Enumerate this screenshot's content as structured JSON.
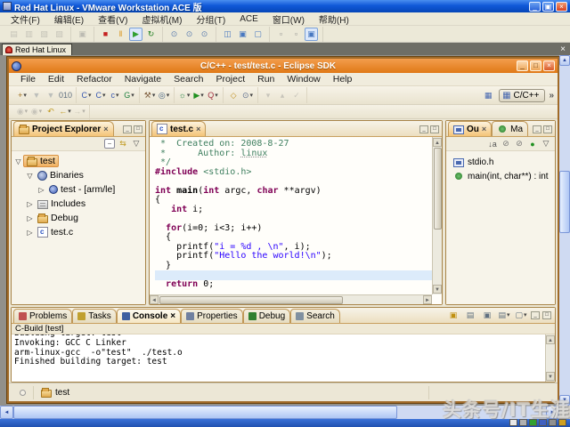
{
  "glyphs": {
    "min": "_",
    "restore": "▣",
    "max": "□",
    "close": "×",
    "up": "▲",
    "down": "▼",
    "left": "◄",
    "right": "►",
    "caret": "▾",
    "menu": "▽",
    "chevron": "»",
    "tab_close": "×",
    "collapse_all": "−",
    "link_editor": "⇆",
    "persp_icon": "▦",
    "open_persp_icon": "▦"
  },
  "vmware": {
    "title": "Red Hat Linux - VMware Workstation ACE 版",
    "menus": [
      "文件(F)",
      "编辑(E)",
      "查看(V)",
      "虚拟机(M)",
      "分组(T)",
      "ACE",
      "窗口(W)",
      "帮助(H)"
    ],
    "toolbar_groups": [
      [
        {
          "n": "vm-settings",
          "g": "▤",
          "c": "#8a8a7a",
          "d": true
        },
        {
          "n": "snapshot-manager",
          "g": "▥",
          "c": "#8a8a7a",
          "d": true
        },
        {
          "n": "clone-vm",
          "g": "▧",
          "c": "#8a8a7a",
          "d": true
        },
        {
          "n": "capture-movie",
          "g": "▨",
          "c": "#8a8a7a",
          "d": true
        }
      ],
      [
        {
          "n": "appliance",
          "g": "▣",
          "c": "#707a8a",
          "d": true
        }
      ],
      [
        {
          "n": "power-off",
          "g": "■",
          "c": "#c42020"
        },
        {
          "n": "suspend",
          "g": "‖",
          "c": "#d89010"
        },
        {
          "n": "power-on",
          "g": "▶",
          "c": "#30a030",
          "active": true
        },
        {
          "n": "reset",
          "g": "↻",
          "c": "#208020"
        }
      ],
      [
        {
          "n": "take-snapshot",
          "g": "⊙",
          "c": "#6080b0"
        },
        {
          "n": "revert-snapshot",
          "g": "⊙",
          "c": "#6080b0"
        },
        {
          "n": "manage-snapshots",
          "g": "⊙",
          "c": "#6080b0"
        }
      ],
      [
        {
          "n": "show-sidebar",
          "g": "◫",
          "c": "#4878c0"
        },
        {
          "n": "summary-view",
          "g": "▣",
          "c": "#4878c0"
        },
        {
          "n": "console-view",
          "g": "▢",
          "c": "#4878c0"
        }
      ],
      [
        {
          "n": "quick-switch",
          "g": "▫",
          "c": "#8a8a8a"
        },
        {
          "n": "fullscreen-mode",
          "g": "▫",
          "c": "#8a8a8a"
        },
        {
          "n": "unity-view",
          "g": "▣",
          "c": "#4878c0",
          "active": true
        }
      ]
    ],
    "tab": "Red Hat Linux"
  },
  "eclipse": {
    "title": "C/C++ - test/test.c - Eclipse SDK",
    "menus": [
      "File",
      "Edit",
      "Refactor",
      "Navigate",
      "Search",
      "Project",
      "Run",
      "Window",
      "Help"
    ],
    "toolbar1_groups": [
      [
        {
          "n": "new-wizard",
          "g": "+",
          "c": "#a07020",
          "caret": true
        },
        {
          "n": "save",
          "g": "▼",
          "c": "#607080",
          "d": true
        },
        {
          "n": "save-all",
          "g": "▼",
          "c": "#607080",
          "d": true
        },
        {
          "n": "build-all",
          "g": "010",
          "c": "#607080"
        }
      ],
      [
        {
          "n": "new-c-project",
          "g": "C",
          "c": "#3858b0",
          "caret": true
        },
        {
          "n": "new-cpp-project",
          "g": "C",
          "c": "#3858b0",
          "caret": true
        },
        {
          "n": "new-c-file",
          "g": "c",
          "c": "#3858b0",
          "caret": true
        },
        {
          "n": "code-template",
          "g": "G",
          "c": "#208040",
          "caret": true
        }
      ],
      [
        {
          "n": "build",
          "g": "⚒",
          "c": "#806040",
          "caret": true
        },
        {
          "n": "build-config",
          "g": "◎",
          "c": "#406080",
          "caret": true
        }
      ],
      [
        {
          "n": "debug",
          "g": "☼",
          "c": "#208040",
          "caret": true
        },
        {
          "n": "run",
          "g": "▶",
          "c": "#209020",
          "caret": true
        },
        {
          "n": "profile",
          "g": "Q",
          "c": "#a03040",
          "caret": true
        }
      ],
      [
        {
          "n": "open-element",
          "g": "◇",
          "c": "#c09020"
        },
        {
          "n": "search",
          "g": "⊙",
          "c": "#607090",
          "caret": true
        }
      ],
      [
        {
          "n": "toggle-mark",
          "g": "▾",
          "c": "#808080",
          "d": true
        },
        {
          "n": "previous-edit",
          "g": "▴",
          "c": "#808080",
          "d": true
        },
        {
          "n": "next-edit",
          "g": "✓",
          "c": "#808080",
          "d": true
        }
      ]
    ],
    "toolbar2_groups": [
      [
        {
          "n": "next-annotation",
          "g": "◉",
          "c": "#808080",
          "d": true,
          "caret": true
        },
        {
          "n": "previous-annotation",
          "g": "◉",
          "c": "#808080",
          "d": true,
          "caret": true
        },
        {
          "n": "last-edit-location",
          "g": "↶",
          "c": "#c09a20"
        },
        {
          "n": "back-history",
          "g": "←",
          "c": "#c09a20",
          "caret": true
        },
        {
          "n": "forward-history",
          "g": "→",
          "c": "#909080",
          "d": true,
          "caret": true
        }
      ]
    ],
    "perspective": {
      "button": "C/C++"
    },
    "project_explorer": {
      "title": "Project Explorer",
      "tree": [
        {
          "label": "test",
          "depth": 0,
          "arrow": "open",
          "icon": "project",
          "selected": true
        },
        {
          "label": "Binaries",
          "depth": 1,
          "arrow": "open",
          "icon": "binaries"
        },
        {
          "label": "test - [arm/le]",
          "depth": 2,
          "arrow": "closed",
          "icon": "binary"
        },
        {
          "label": "Includes",
          "depth": 1,
          "arrow": "closed",
          "icon": "includes"
        },
        {
          "label": "Debug",
          "depth": 1,
          "arrow": "closed",
          "icon": "folder"
        },
        {
          "label": "test.c",
          "depth": 1,
          "arrow": "closed",
          "icon": "cfile"
        }
      ]
    },
    "editor": {
      "tab": "test.c",
      "highlight_line": 14,
      "lines": [
        [
          {
            "t": " *  Created on: 2008-8-27",
            "s": "com"
          }
        ],
        [
          {
            "t": " *      Author: ",
            "s": "com"
          },
          {
            "t": "linux",
            "s": "comu"
          }
        ],
        [
          {
            "t": " */",
            "s": "com"
          }
        ],
        [
          {
            "t": "#include",
            "s": "pp"
          },
          {
            "t": " ",
            "s": "pl"
          },
          {
            "t": "<stdio.h>",
            "s": "inc"
          }
        ],
        [],
        [
          {
            "t": "int",
            "s": "kw"
          },
          {
            "t": " ",
            "s": "pl"
          },
          {
            "t": "main",
            "s": "fn"
          },
          {
            "t": "(",
            "s": "pl"
          },
          {
            "t": "int",
            "s": "kw"
          },
          {
            "t": " argc, ",
            "s": "pl"
          },
          {
            "t": "char",
            "s": "kw"
          },
          {
            "t": " **argv)",
            "s": "pl"
          }
        ],
        [
          {
            "t": "{",
            "s": "pl"
          }
        ],
        [
          {
            "t": "   ",
            "s": "pl"
          },
          {
            "t": "int",
            "s": "kw"
          },
          {
            "t": " i;",
            "s": "pl"
          }
        ],
        [],
        [
          {
            "t": "  ",
            "s": "pl"
          },
          {
            "t": "for",
            "s": "kw"
          },
          {
            "t": "(i=0; i<3; i++)",
            "s": "pl"
          }
        ],
        [
          {
            "t": "  {",
            "s": "pl"
          }
        ],
        [
          {
            "t": "    printf(",
            "s": "pl"
          },
          {
            "t": "\"i = %d , \\n\"",
            "s": "str"
          },
          {
            "t": ", i);",
            "s": "pl"
          }
        ],
        [
          {
            "t": "    printf(",
            "s": "pl"
          },
          {
            "t": "\"Hello the world!\\n\"",
            "s": "str"
          },
          {
            "t": ");",
            "s": "pl"
          }
        ],
        [
          {
            "t": "  }",
            "s": "pl"
          }
        ],
        [],
        [
          {
            "t": "  ",
            "s": "pl"
          },
          {
            "t": "return",
            "s": "kw"
          },
          {
            "t": " 0;",
            "s": "pl"
          }
        ]
      ]
    },
    "outline": {
      "tabs": [
        {
          "label": "Ou",
          "active": true
        },
        {
          "label": "Ma",
          "active": false
        }
      ],
      "toolbar": [
        {
          "n": "sort",
          "g": "↓a",
          "c": "#555"
        },
        {
          "n": "hide-fields",
          "g": "⊘",
          "c": "#777"
        },
        {
          "n": "hide-static",
          "g": "⊘",
          "c": "#777"
        },
        {
          "n": "hide-non-public",
          "g": "●",
          "c": "#209020"
        },
        {
          "n": "view-menu",
          "g": "▽",
          "c": "#555"
        }
      ],
      "items": [
        {
          "label": "stdio.h",
          "icon": "include-sq"
        },
        {
          "label": "main(int, char**) : int",
          "icon": "method"
        }
      ]
    },
    "console": {
      "tabs": [
        {
          "label": "Problems",
          "icon_color": "#c05050",
          "active": false
        },
        {
          "label": "Tasks",
          "icon_color": "#c0a030",
          "active": false
        },
        {
          "label": "Console",
          "icon_color": "#4060a0",
          "active": true
        },
        {
          "label": "Properties",
          "icon_color": "#7080a0",
          "active": false
        },
        {
          "label": "Debug",
          "icon_color": "#308030",
          "active": false
        },
        {
          "label": "Search",
          "icon_color": "#8090a0",
          "active": false
        }
      ],
      "toolbar": [
        {
          "n": "scroll-lock",
          "g": "▣",
          "c": "#c09010"
        },
        {
          "n": "clear-console",
          "g": "▤",
          "c": "#607080"
        },
        {
          "n": "pin-console",
          "g": "▣",
          "c": "#607080"
        },
        {
          "n": "display-selected-console",
          "g": "▤",
          "c": "#607080",
          "caret": true
        },
        {
          "n": "open-console",
          "g": "▢",
          "c": "#607080",
          "caret": true
        }
      ],
      "label": "C-Build [test]",
      "lines": [
        "Building target: test",
        "Invoking: GCC C Linker",
        "arm-linux-gcc  -o\"test\"  ./test.o",
        "Finished building target: test"
      ]
    },
    "status": {
      "project": "test"
    }
  },
  "vm_status_icons": [
    {
      "n": "pointer-status",
      "c": "#e8e8e8"
    },
    {
      "n": "floppy-status",
      "c": "#b0b0b0"
    },
    {
      "n": "display-status",
      "c": "#30a030"
    },
    {
      "n": "audio-status",
      "c": "#4060c0"
    },
    {
      "n": "network-status",
      "c": "#909090"
    },
    {
      "n": "usb-status",
      "c": "#d0a020"
    }
  ],
  "watermark": "头条号/IT生涯",
  "colors": {
    "eclipse_titlebar": "#e07916",
    "xp_titlebar": "#1058d8",
    "highlight_line": "#dcebfa",
    "keyword": "#7f0055",
    "string": "#2a00ff",
    "comment": "#3f7f5f"
  }
}
